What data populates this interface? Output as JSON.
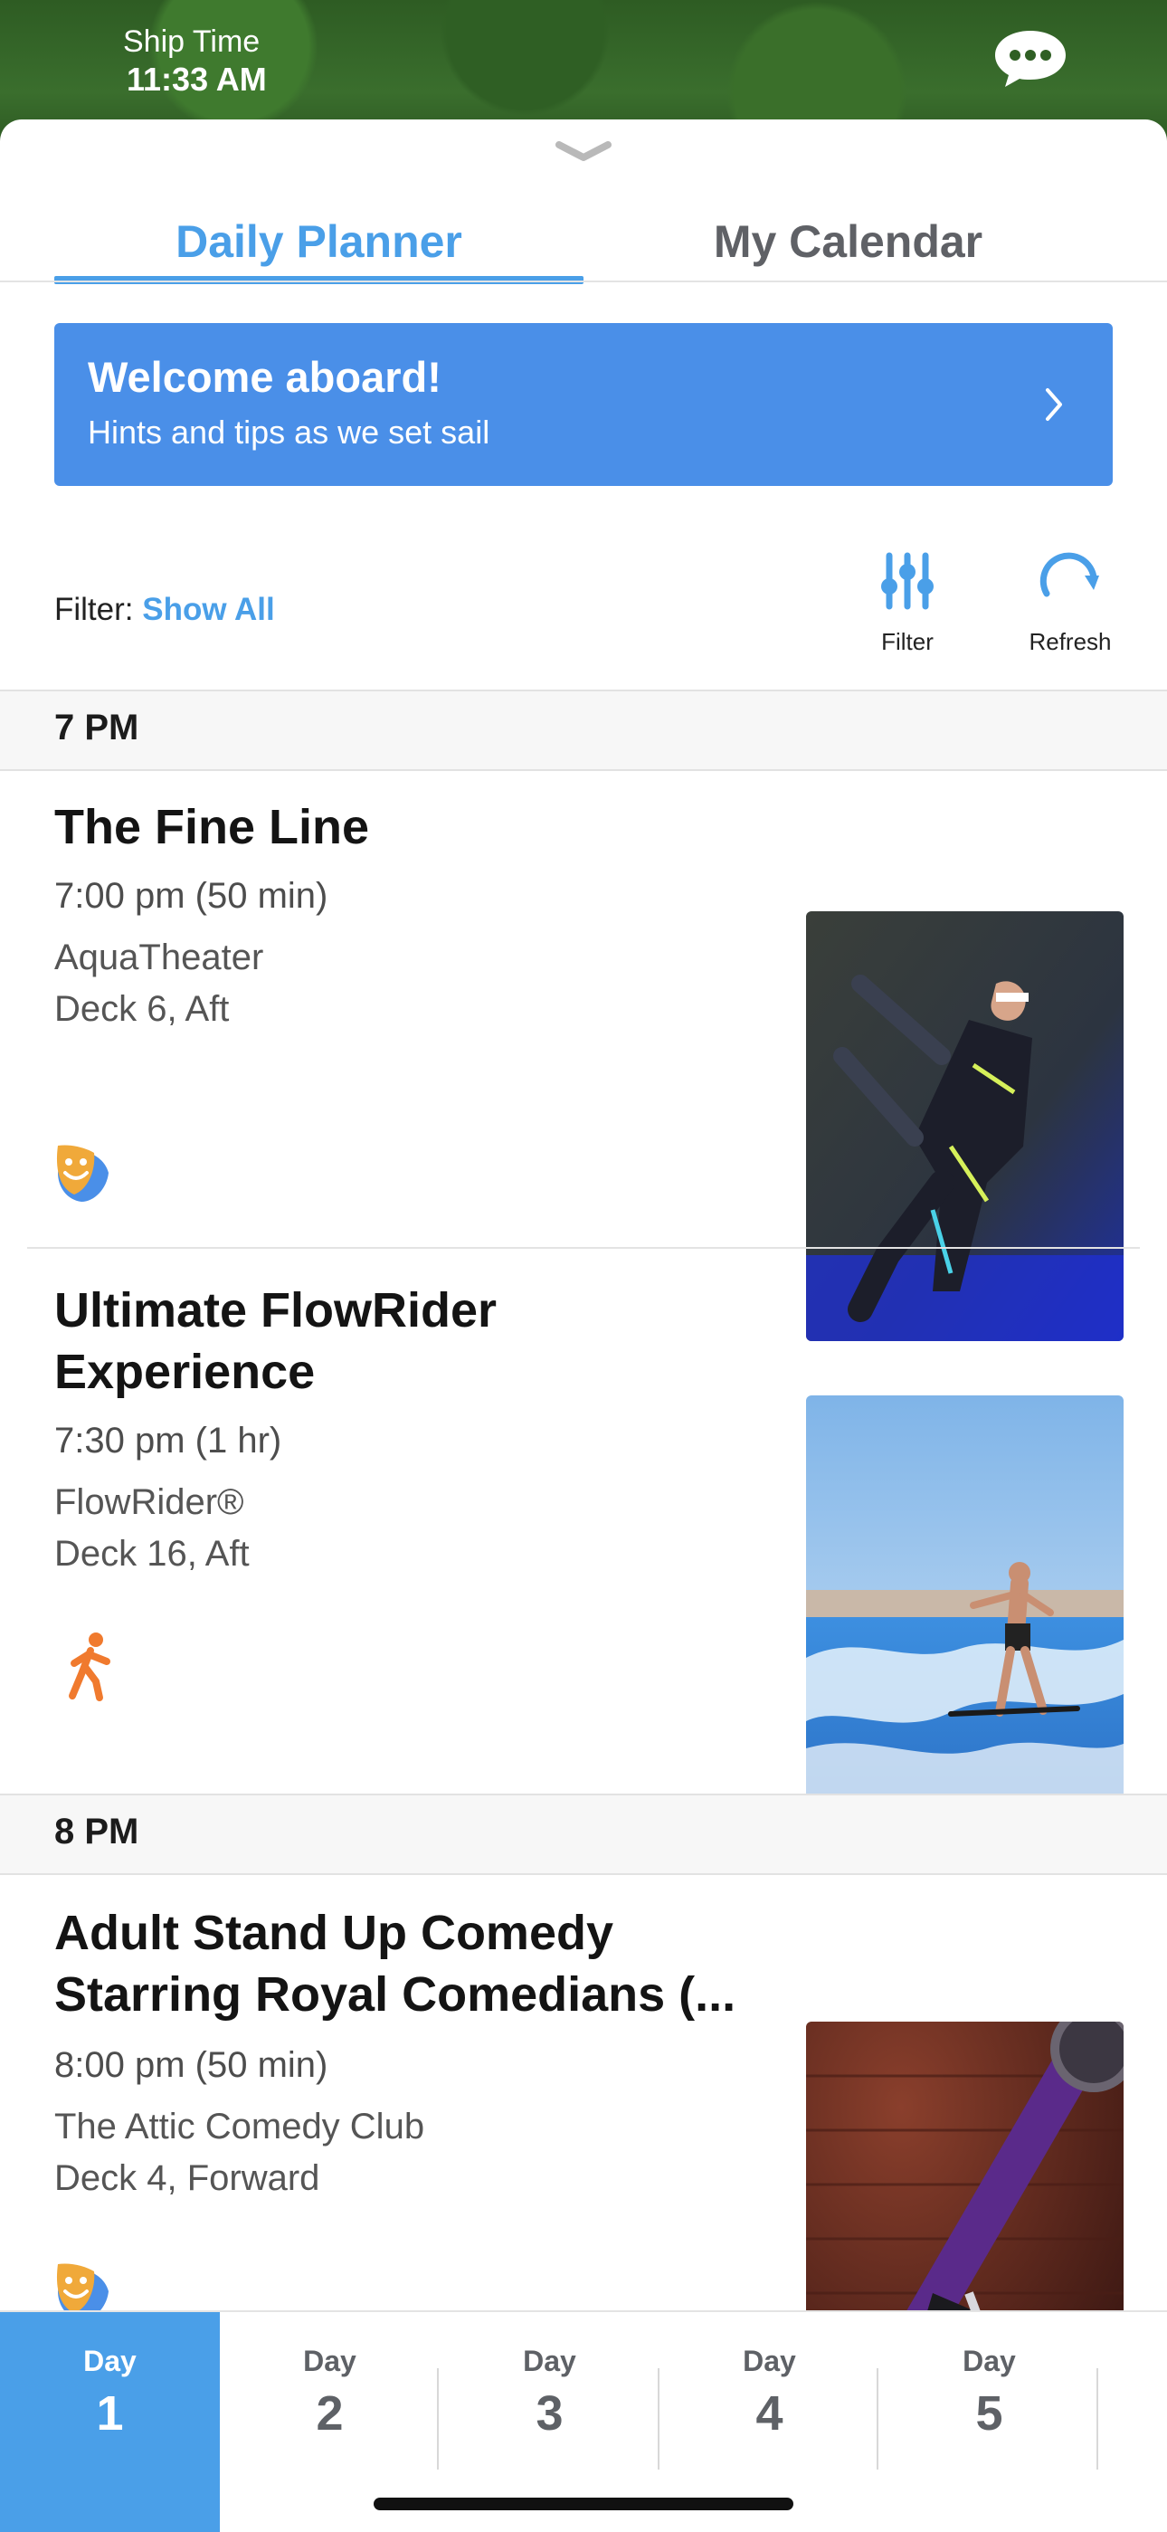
{
  "header": {
    "ship_time_label": "Ship Time",
    "ship_time": "11:33 AM",
    "chat_icon": "chat-bubble-icon"
  },
  "tabs": [
    {
      "label": "Daily Planner",
      "active": true
    },
    {
      "label": "My Calendar",
      "active": false
    }
  ],
  "welcome": {
    "title": "Welcome aboard!",
    "subtitle": "Hints and tips as we set sail"
  },
  "filter": {
    "label": "Filter:",
    "value": "Show All",
    "filter_button": "Filter",
    "refresh_button": "Refresh"
  },
  "schedule": [
    {
      "hour": "7 PM",
      "events": [
        {
          "title": "The Fine Line",
          "time": "7:00 pm (50 min)",
          "venue": "AquaTheater",
          "deck": "Deck 6, Aft",
          "category_icon": "theater-masks-icon",
          "photo": "acrobat-performer-photo"
        },
        {
          "title": "Ultimate FlowRider Experience",
          "time": "7:30 pm (1 hr)",
          "venue": "FlowRider®",
          "deck": "Deck 16, Aft",
          "category_icon": "running-person-icon",
          "photo": "flowrider-surfer-photo"
        }
      ]
    },
    {
      "hour": "8 PM",
      "events": [
        {
          "title": "Adult Stand Up Comedy Starring Royal Comedians (...",
          "time": "8:00 pm (50 min)",
          "venue": "The Attic Comedy Club",
          "deck": "Deck 4, Forward",
          "category_icon": "theater-masks-icon",
          "photo": "microphone-photo"
        }
      ]
    }
  ],
  "days": [
    {
      "label": "Day",
      "number": "1",
      "active": true
    },
    {
      "label": "Day",
      "number": "2",
      "active": false
    },
    {
      "label": "Day",
      "number": "3",
      "active": false
    },
    {
      "label": "Day",
      "number": "4",
      "active": false
    },
    {
      "label": "Day",
      "number": "5",
      "active": false
    }
  ],
  "colors": {
    "accent": "#4a9fe8",
    "banner": "#4a8fe8",
    "theater_icon_orange": "#f0a93a",
    "theater_icon_blue": "#4a8fe8",
    "activity_icon": "#f07a2e"
  }
}
